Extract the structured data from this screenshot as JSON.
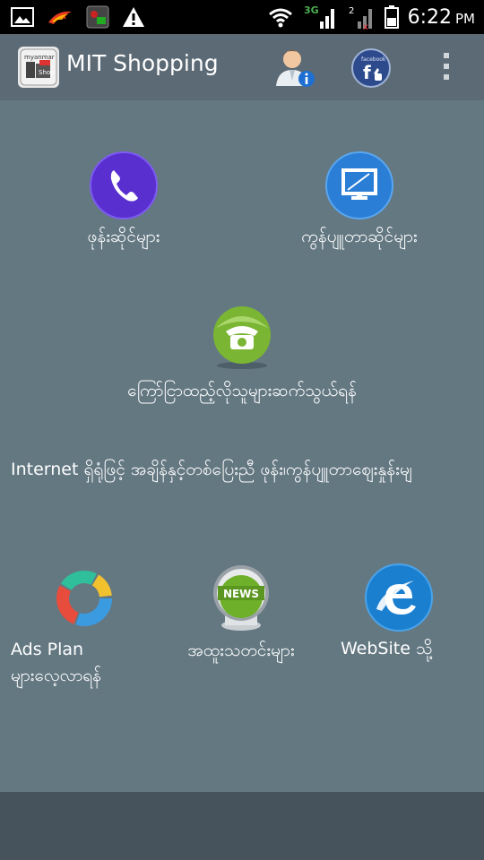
{
  "status_bar": {
    "time": "6:22",
    "ampm": "PM",
    "icons": [
      "gallery-icon",
      "flame-icon",
      "game-icon",
      "warning-icon",
      "wifi-icon",
      "signal-3g-icon",
      "signal-2-icon",
      "battery-icon"
    ],
    "network": "3G"
  },
  "action_bar": {
    "title": "MIT Shopping",
    "icons": [
      "app-logo-icon",
      "user-info-icon",
      "facebook-icon",
      "overflow-menu-icon"
    ]
  },
  "tiles": {
    "phone_shops": "ဖုန်းဆိုင်များ",
    "computer_shops": "ကွန်ပျူတာဆိုင်များ",
    "contact_advertisers": "ကြော်ငြာထည့်လိုသူများဆက်သွယ်ရန်",
    "ads_plan_line1": "Ads Plan",
    "ads_plan_line2": "များလေ့လာရန်",
    "news": "အထူးသတင်းများ",
    "website": "WebSite သို့"
  },
  "marquee_text": "Internet ရှိရုံဖြင့် အချိန်နှင့်တစ်ပြေးညီ ဖုန်း၊ကွန်ပျူတာဈေးနှုန်းမျ",
  "colors": {
    "content_bg": "#647882",
    "action_bar_bg": "#5b6a75",
    "status_bar_bg": "#000000",
    "phone_icon": "#5a2fd0",
    "computer_icon": "#2a7ed6",
    "contact_icon": "#8cc63f",
    "ie_icon": "#1b7fd0"
  },
  "news_badge": "NEWS"
}
